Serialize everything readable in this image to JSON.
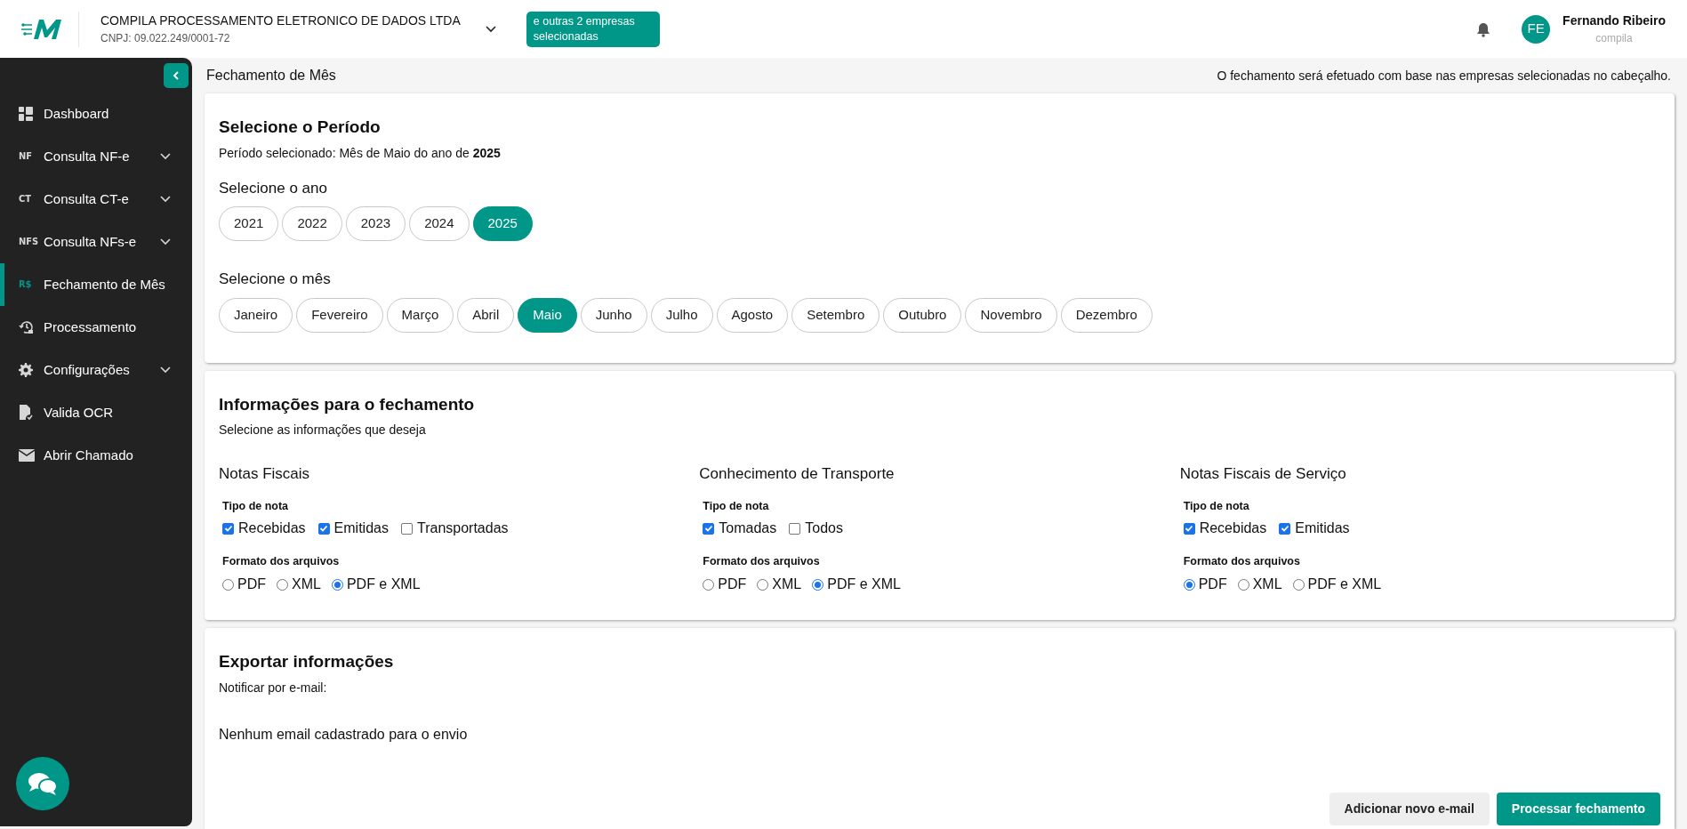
{
  "header": {
    "company": "COMPILA PROCESSAMENTO ELETRONICO DE DADOS LTDA",
    "cnpj": "CNPJ: 09.022.249/0001-72",
    "others_badge": "e outras 2 empresas selecionadas",
    "user_initials": "FE",
    "user_name": "Fernando Ribeiro",
    "user_org": "compila"
  },
  "sidebar": {
    "items": [
      {
        "label": "Dashboard",
        "selected": false,
        "has_submenu": false
      },
      {
        "label": "Consulta NF-e",
        "glyph": "NF",
        "selected": false,
        "has_submenu": true
      },
      {
        "label": "Consulta CT-e",
        "glyph": "CT",
        "selected": false,
        "has_submenu": true
      },
      {
        "label": "Consulta NFs-e",
        "glyph": "NFS",
        "selected": false,
        "has_submenu": true
      },
      {
        "label": "Fechamento de Mês",
        "glyph": "R$",
        "selected": true,
        "has_submenu": false
      },
      {
        "label": "Processamento",
        "selected": false,
        "has_submenu": false
      },
      {
        "label": "Configurações",
        "selected": false,
        "has_submenu": true
      },
      {
        "label": "Valida OCR",
        "selected": false,
        "has_submenu": false
      },
      {
        "label": "Abrir Chamado",
        "selected": false,
        "has_submenu": false
      }
    ]
  },
  "page": {
    "title": "Fechamento de Mês",
    "note": "O fechamento será efetuado com base nas empresas selecionadas no cabeçalho."
  },
  "period": {
    "title": "Selecione o Período",
    "summary": "Período selecionado: Mês de Maio do ano de **2025**",
    "year_label": "Selecione o ano",
    "years": [
      {
        "label": "2021",
        "selected": false
      },
      {
        "label": "2022",
        "selected": false
      },
      {
        "label": "2023",
        "selected": false
      },
      {
        "label": "2024",
        "selected": false
      },
      {
        "label": "2025",
        "selected": true
      }
    ],
    "month_label": "Selecione o mês",
    "months": [
      {
        "label": "Janeiro",
        "selected": false
      },
      {
        "label": "Fevereiro",
        "selected": false
      },
      {
        "label": "Março",
        "selected": false
      },
      {
        "label": "Abril",
        "selected": false
      },
      {
        "label": "Maio",
        "selected": true
      },
      {
        "label": "Junho",
        "selected": false
      },
      {
        "label": "Julho",
        "selected": false
      },
      {
        "label": "Agosto",
        "selected": false
      },
      {
        "label": "Setembro",
        "selected": false
      },
      {
        "label": "Outubro",
        "selected": false
      },
      {
        "label": "Novembro",
        "selected": false
      },
      {
        "label": "Dezembro",
        "selected": false
      }
    ]
  },
  "info": {
    "title": "Informações para o fechamento",
    "subtitle": "Selecione as informações que deseja",
    "groups": [
      {
        "title": "Notas Fiscais",
        "type_label": "Tipo de nota",
        "types": [
          {
            "label": "Recebidas",
            "checked": true
          },
          {
            "label": "Emitidas",
            "checked": true
          },
          {
            "label": "Transportadas",
            "checked": false
          }
        ],
        "format_label": "Formato dos arquivos",
        "formats": [
          {
            "label": "PDF",
            "selected": false
          },
          {
            "label": "XML",
            "selected": false
          },
          {
            "label": "PDF e XML",
            "selected": true
          }
        ]
      },
      {
        "title": "Conhecimento de Transporte",
        "type_label": "Tipo de nota",
        "types": [
          {
            "label": "Tomadas",
            "checked": true
          },
          {
            "label": "Todos",
            "checked": false
          }
        ],
        "format_label": "Formato dos arquivos",
        "formats": [
          {
            "label": "PDF",
            "selected": false
          },
          {
            "label": "XML",
            "selected": false
          },
          {
            "label": "PDF e XML",
            "selected": true
          }
        ]
      },
      {
        "title": "Notas Fiscais de Serviço",
        "type_label": "Tipo de nota",
        "types": [
          {
            "label": "Recebidas",
            "checked": true
          },
          {
            "label": "Emitidas",
            "checked": true
          }
        ],
        "format_label": "Formato dos arquivos",
        "formats": [
          {
            "label": "PDF",
            "selected": true
          },
          {
            "label": "XML",
            "selected": false
          },
          {
            "label": "PDF e XML",
            "selected": false
          }
        ]
      }
    ]
  },
  "export": {
    "title": "Exportar informações",
    "notify_label": "Notificar por e-mail:",
    "empty": "Nenhum email cadastrado para o envio",
    "buttons": [
      {
        "label": "Adicionar novo e-mail",
        "kind": "secondary"
      },
      {
        "label": "Processar fechamento",
        "kind": "primary"
      }
    ]
  }
}
